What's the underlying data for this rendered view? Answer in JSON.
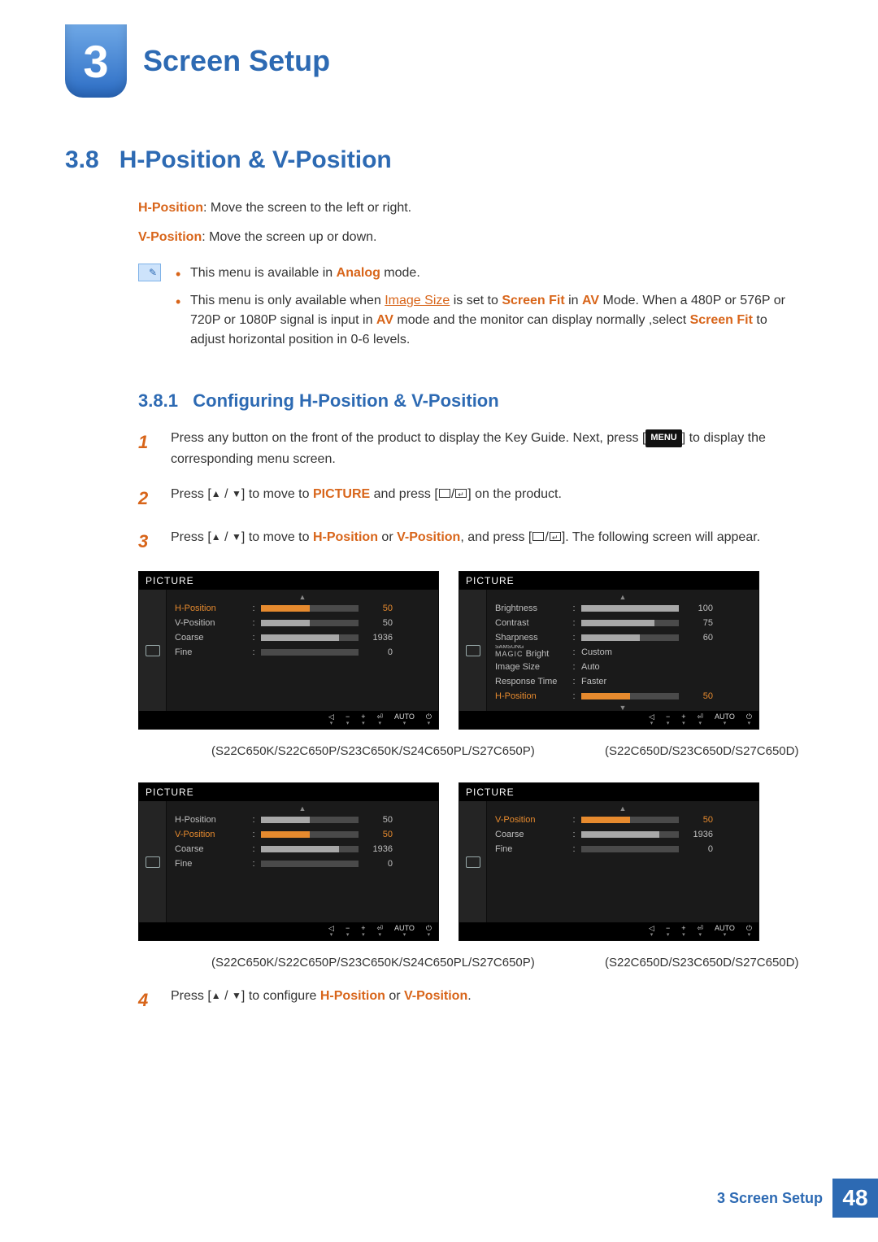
{
  "header": {
    "chapter_num": "3",
    "chapter_title": "Screen Setup"
  },
  "section": {
    "num": "3.8",
    "title": "H-Position & V-Position"
  },
  "def": {
    "hpos_label": "H-Position",
    "hpos_text": ": Move the screen to the left or right.",
    "vpos_label": "V-Position",
    "vpos_text": ": Move the screen up or down."
  },
  "notes": {
    "n1_pre": "This menu is available in ",
    "n1_mode": "Analog",
    "n1_post": " mode.",
    "n2_pre": "This menu is only available when ",
    "n2_link": "Image Size",
    "n2_mid1": " is set to ",
    "n2_fit": "Screen Fit",
    "n2_mid2": " in ",
    "n2_av": "AV",
    "n2_mid3": " Mode. When a 480P or 576P or 720P or 1080P signal is input in ",
    "n2_av2": "AV",
    "n2_mid4": " mode and the monitor can display normally ,select ",
    "n2_fit2": "Screen Fit",
    "n2_post": " to adjust horizontal position in 0-6 levels."
  },
  "subsection": {
    "num": "3.8.1",
    "title": "Configuring H-Position & V-Position"
  },
  "steps": {
    "s1_num": "1",
    "s1_a": "Press any button on the front of the product to display the Key Guide. Next, press [",
    "s1_menu": "MENU",
    "s1_b": "] to display the corresponding menu screen.",
    "s2_num": "2",
    "s2_a": "Press [",
    "s2_b": "] to move to ",
    "s2_pic": "PICTURE",
    "s2_c": " and press [",
    "s2_d": "] on the product.",
    "s3_num": "3",
    "s3_a": "Press [",
    "s3_b": "] to move to ",
    "s3_h": "H-Position",
    "s3_or": " or ",
    "s3_v": "V-Position",
    "s3_c": ", and press [",
    "s3_d": "]. The following screen will appear.",
    "s4_num": "4",
    "s4_a": "Press [",
    "s4_b": "] to configure ",
    "s4_h": "H-Position",
    "s4_or": " or ",
    "s4_v": "V-Position",
    "s4_post": "."
  },
  "captions": {
    "c1": "(S22C650K/S22C650P/S23C650K/S24C650PL/S27C650P)",
    "c2": "(S22C650D/S23C650D/S27C650D)",
    "c3": "(S22C650K/S22C650P/S23C650K/S24C650PL/S27C650P)",
    "c4": "(S22C650D/S23C650D/S27C650D)"
  },
  "osd": {
    "title": "PICTURE",
    "btn_auto": "AUTO",
    "panel1": [
      {
        "label": "H-Position",
        "val": "50",
        "fillPct": 50,
        "sel": true
      },
      {
        "label": "V-Position",
        "val": "50",
        "fillPct": 50
      },
      {
        "label": "Coarse",
        "val": "1936",
        "fillPct": 80
      },
      {
        "label": "Fine",
        "val": "0",
        "fillPct": 0
      }
    ],
    "panel2": [
      {
        "label": "Brightness",
        "val": "100",
        "fillPct": 100
      },
      {
        "label": "Contrast",
        "val": "75",
        "fillPct": 75
      },
      {
        "label": "Sharpness",
        "val": "60",
        "fillPct": 60
      },
      {
        "label": "MAGIC Bright",
        "text": "Custom",
        "magic": true
      },
      {
        "label": "Image Size",
        "text": "Auto"
      },
      {
        "label": "Response Time",
        "text": "Faster"
      },
      {
        "label": "H-Position",
        "val": "50",
        "fillPct": 50,
        "sel": true
      }
    ],
    "panel3": [
      {
        "label": "H-Position",
        "val": "50",
        "fillPct": 50
      },
      {
        "label": "V-Position",
        "val": "50",
        "fillPct": 50,
        "sel": true
      },
      {
        "label": "Coarse",
        "val": "1936",
        "fillPct": 80
      },
      {
        "label": "Fine",
        "val": "0",
        "fillPct": 0
      }
    ],
    "panel4": [
      {
        "label": "V-Position",
        "val": "50",
        "fillPct": 50,
        "sel": true
      },
      {
        "label": "Coarse",
        "val": "1936",
        "fillPct": 80
      },
      {
        "label": "Fine",
        "val": "0",
        "fillPct": 0
      }
    ],
    "magic_top": "SAMSUNG",
    "magic_bot": "MAGIC"
  },
  "footer": {
    "label": "3 Screen Setup",
    "page": "48"
  }
}
